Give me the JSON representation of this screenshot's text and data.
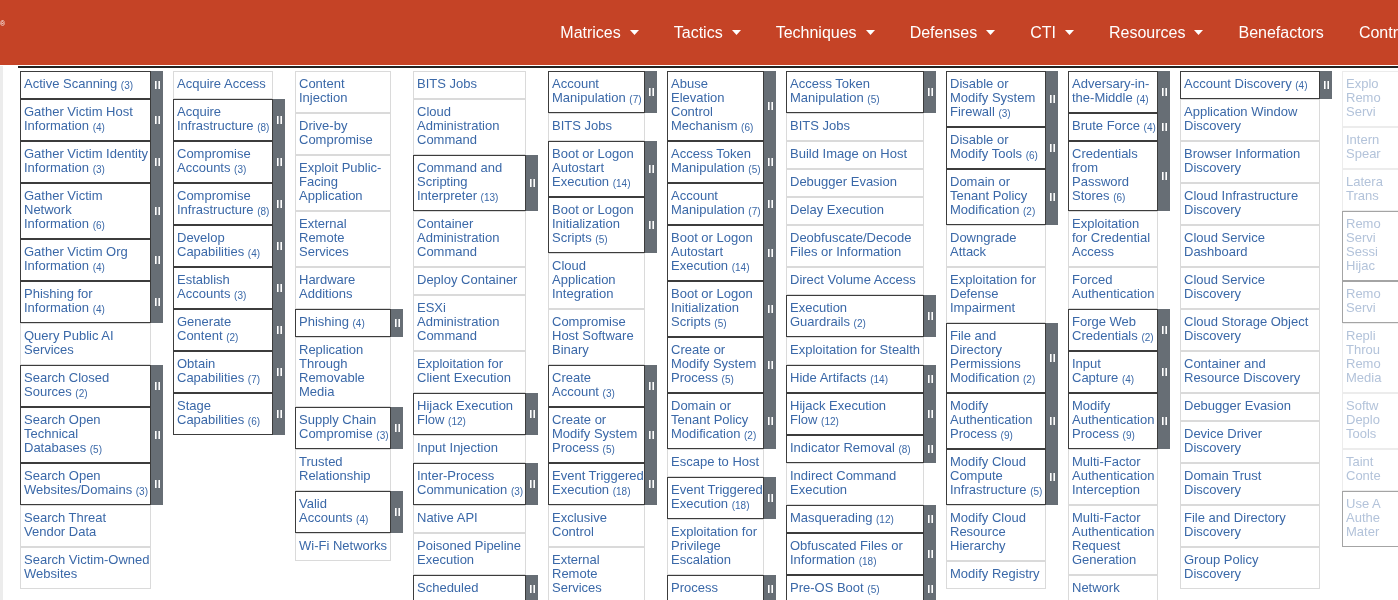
{
  "navbar": {
    "logo_mark": "®",
    "items": [
      {
        "label": "Matrices",
        "dropdown": true
      },
      {
        "label": "Tactics",
        "dropdown": true
      },
      {
        "label": "Techniques",
        "dropdown": true
      },
      {
        "label": "Defenses",
        "dropdown": true
      },
      {
        "label": "CTI",
        "dropdown": true
      },
      {
        "label": "Resources",
        "dropdown": true
      },
      {
        "label": "Benefactors",
        "dropdown": false
      },
      {
        "label": "Contr",
        "dropdown": false
      }
    ]
  },
  "matrix": {
    "columns": [
      {
        "faded": false,
        "techniques": [
          {
            "name": "Active Scanning",
            "count": "(3)",
            "kind": "parent"
          },
          {
            "name": "Gather Victim Host Information",
            "count": "(4)",
            "kind": "parent"
          },
          {
            "name": "Gather Victim Identity Information",
            "count": "(3)",
            "kind": "parent"
          },
          {
            "name": "Gather Victim Network Information",
            "count": "(6)",
            "kind": "parent"
          },
          {
            "name": "Gather Victim Org Information",
            "count": "(4)",
            "kind": "parent"
          },
          {
            "name": "Phishing for Information",
            "count": "(4)",
            "kind": "parent"
          },
          {
            "name": "Query Public AI Services",
            "kind": "single"
          },
          {
            "name": "Search Closed Sources",
            "count": "(2)",
            "kind": "parent"
          },
          {
            "name": "Search Open Technical Databases",
            "count": "(5)",
            "kind": "parent"
          },
          {
            "name": "Search Open Websites/Domains",
            "count": "(3)",
            "kind": "parent"
          },
          {
            "name": "Search Threat Vendor Data",
            "kind": "single"
          },
          {
            "name": "Search Victim-Owned Websites",
            "kind": "single"
          }
        ]
      },
      {
        "faded": false,
        "techniques": [
          {
            "name": "Acquire Access",
            "kind": "single"
          },
          {
            "name": "Acquire Infrastructure",
            "count": "(8)",
            "kind": "parent"
          },
          {
            "name": "Compromise Accounts",
            "count": "(3)",
            "kind": "parent"
          },
          {
            "name": "Compromise Infrastructure",
            "count": "(8)",
            "kind": "parent"
          },
          {
            "name": "Develop Capabilities",
            "count": "(4)",
            "kind": "parent"
          },
          {
            "name": "Establish Accounts",
            "count": "(3)",
            "kind": "parent"
          },
          {
            "name": "Generate Content",
            "count": "(2)",
            "kind": "parent"
          },
          {
            "name": "Obtain Capabilities",
            "count": "(7)",
            "kind": "parent"
          },
          {
            "name": "Stage Capabilities",
            "count": "(6)",
            "kind": "parent"
          }
        ]
      },
      {
        "faded": false,
        "techniques": [
          {
            "name": "Content Injection",
            "kind": "single"
          },
          {
            "name": "Drive-by Compromise",
            "kind": "single"
          },
          {
            "name": "Exploit Public-Facing Application",
            "kind": "single"
          },
          {
            "name": "External Remote Services",
            "kind": "single"
          },
          {
            "name": "Hardware Additions",
            "kind": "single"
          },
          {
            "name": "Phishing",
            "count": "(4)",
            "kind": "parent"
          },
          {
            "name": "Replication Through Removable Media",
            "kind": "single"
          },
          {
            "name": "Supply Chain Compromise",
            "count": "(3)",
            "kind": "parent"
          },
          {
            "name": "Trusted Relationship",
            "kind": "single"
          },
          {
            "name": "Valid Accounts",
            "count": "(4)",
            "kind": "parent"
          },
          {
            "name": "Wi-Fi Networks",
            "kind": "single"
          }
        ]
      },
      {
        "faded": false,
        "techniques": [
          {
            "name": "BITS Jobs",
            "kind": "single"
          },
          {
            "name": "Cloud Administration Command",
            "kind": "single"
          },
          {
            "name": "Command and Scripting Interpreter",
            "count": "(13)",
            "kind": "parent"
          },
          {
            "name": "Container Administration Command",
            "kind": "single"
          },
          {
            "name": "Deploy Container",
            "kind": "single"
          },
          {
            "name": "ESXi Administration Command",
            "kind": "single"
          },
          {
            "name": "Exploitation for Client Execution",
            "kind": "single"
          },
          {
            "name": "Hijack Execution Flow",
            "count": "(12)",
            "kind": "parent"
          },
          {
            "name": "Input Injection",
            "kind": "single"
          },
          {
            "name": "Inter-Process Communication",
            "count": "(3)",
            "kind": "parent"
          },
          {
            "name": "Native API",
            "kind": "single"
          },
          {
            "name": "Poisoned Pipeline Execution",
            "kind": "single"
          },
          {
            "name": "Scheduled",
            "kind": "parent"
          }
        ]
      },
      {
        "faded": false,
        "techniques": [
          {
            "name": "Account Manipulation",
            "count": "(7)",
            "kind": "parent"
          },
          {
            "name": "BITS Jobs",
            "kind": "single"
          },
          {
            "name": "Boot or Logon Autostart Execution",
            "count": "(14)",
            "kind": "parent"
          },
          {
            "name": "Boot or Logon Initialization Scripts",
            "count": "(5)",
            "kind": "parent"
          },
          {
            "name": "Cloud Application Integration",
            "kind": "single"
          },
          {
            "name": "Compromise Host Software Binary",
            "kind": "single"
          },
          {
            "name": "Create Account",
            "count": "(3)",
            "kind": "parent"
          },
          {
            "name": "Create or Modify System Process",
            "count": "(5)",
            "kind": "parent"
          },
          {
            "name": "Event Triggered Execution",
            "count": "(18)",
            "kind": "parent"
          },
          {
            "name": "Exclusive Control",
            "kind": "single"
          },
          {
            "name": "External Remote Services",
            "kind": "single"
          }
        ]
      },
      {
        "faded": false,
        "techniques": [
          {
            "name": "Abuse Elevation Control Mechanism",
            "count": "(6)",
            "kind": "parent"
          },
          {
            "name": "Access Token Manipulation",
            "count": "(5)",
            "kind": "parent"
          },
          {
            "name": "Account Manipulation",
            "count": "(7)",
            "kind": "parent"
          },
          {
            "name": "Boot or Logon Autostart Execution",
            "count": "(14)",
            "kind": "parent"
          },
          {
            "name": "Boot or Logon Initialization Scripts",
            "count": "(5)",
            "kind": "parent"
          },
          {
            "name": "Create or Modify System Process",
            "count": "(5)",
            "kind": "parent"
          },
          {
            "name": "Domain or Tenant Policy Modification",
            "count": "(2)",
            "kind": "parent"
          },
          {
            "name": "Escape to Host",
            "kind": "single"
          },
          {
            "name": "Event Triggered Execution",
            "count": "(18)",
            "kind": "parent"
          },
          {
            "name": "Exploitation for Privilege Escalation",
            "kind": "single"
          },
          {
            "name": "Process",
            "kind": "parent"
          }
        ]
      },
      {
        "faded": false,
        "techniques": [
          {
            "name": "Access Token Manipulation",
            "count": "(5)",
            "kind": "parent"
          },
          {
            "name": "BITS Jobs",
            "kind": "single"
          },
          {
            "name": "Build Image on Host",
            "kind": "single"
          },
          {
            "name": "Debugger Evasion",
            "kind": "single"
          },
          {
            "name": "Delay Execution",
            "kind": "single"
          },
          {
            "name": "Deobfuscate/Decode Files or Information",
            "kind": "single"
          },
          {
            "name": "Direct Volume Access",
            "kind": "single"
          },
          {
            "name": "Execution Guardrails",
            "count": "(2)",
            "kind": "parent"
          },
          {
            "name": "Exploitation for Stealth",
            "kind": "single"
          },
          {
            "name": "Hide Artifacts",
            "count": "(14)",
            "kind": "parent"
          },
          {
            "name": "Hijack Execution Flow",
            "count": "(12)",
            "kind": "parent"
          },
          {
            "name": "Indicator Removal",
            "count": "(8)",
            "kind": "parent"
          },
          {
            "name": "Indirect Command Execution",
            "kind": "single"
          },
          {
            "name": "Masquerading",
            "count": "(12)",
            "kind": "parent"
          },
          {
            "name": "Obfuscated Files or Information",
            "count": "(18)",
            "kind": "parent"
          },
          {
            "name": "Pre-OS Boot",
            "count": "(5)",
            "kind": "parent"
          }
        ]
      },
      {
        "faded": false,
        "techniques": [
          {
            "name": "Disable or Modify System Firewall",
            "count": "(3)",
            "kind": "parent"
          },
          {
            "name": "Disable or Modify Tools",
            "count": "(6)",
            "kind": "parent"
          },
          {
            "name": "Domain or Tenant Policy Modification",
            "count": "(2)",
            "kind": "parent"
          },
          {
            "name": "Downgrade Attack",
            "kind": "single"
          },
          {
            "name": "Exploitation for Defense Impairment",
            "kind": "single"
          },
          {
            "name": "File and Directory Permissions Modification",
            "count": "(2)",
            "kind": "parent"
          },
          {
            "name": "Modify Authentication Process",
            "count": "(9)",
            "kind": "parent"
          },
          {
            "name": "Modify Cloud Compute Infrastructure",
            "count": "(5)",
            "kind": "parent"
          },
          {
            "name": "Modify Cloud Resource Hierarchy",
            "kind": "single"
          },
          {
            "name": "Modify Registry",
            "kind": "single"
          }
        ]
      },
      {
        "faded": false,
        "techniques": [
          {
            "name": "Adversary-in-the-Middle",
            "count": "(4)",
            "kind": "parent"
          },
          {
            "name": "Brute Force",
            "count": "(4)",
            "kind": "parent"
          },
          {
            "name": "Credentials from Password Stores",
            "count": "(6)",
            "kind": "parent"
          },
          {
            "name": "Exploitation for Credential Access",
            "kind": "single"
          },
          {
            "name": "Forced Authentication",
            "kind": "single"
          },
          {
            "name": "Forge Web Credentials",
            "count": "(2)",
            "kind": "parent"
          },
          {
            "name": "Input Capture",
            "count": "(4)",
            "kind": "parent"
          },
          {
            "name": "Modify Authentication Process",
            "count": "(9)",
            "kind": "parent"
          },
          {
            "name": "Multi-Factor Authentication Interception",
            "kind": "single"
          },
          {
            "name": "Multi-Factor Authentication Request Generation",
            "kind": "single"
          },
          {
            "name": "Network",
            "kind": "single"
          }
        ]
      },
      {
        "faded": false,
        "techniques": [
          {
            "name": "Account Discovery",
            "count": "(4)",
            "kind": "parent"
          },
          {
            "name": "Application Window Discovery",
            "kind": "single"
          },
          {
            "name": "Browser Information Discovery",
            "kind": "single"
          },
          {
            "name": "Cloud Infrastructure Discovery",
            "kind": "single"
          },
          {
            "name": "Cloud Service Dashboard",
            "kind": "single"
          },
          {
            "name": "Cloud Service Discovery",
            "kind": "single"
          },
          {
            "name": "Cloud Storage Object Discovery",
            "kind": "single"
          },
          {
            "name": "Container and Resource Discovery",
            "kind": "single"
          },
          {
            "name": "Debugger Evasion",
            "kind": "single"
          },
          {
            "name": "Device Driver Discovery",
            "kind": "single"
          },
          {
            "name": "Domain Trust Discovery",
            "kind": "single"
          },
          {
            "name": "File and Directory Discovery",
            "kind": "single"
          },
          {
            "name": "Group Policy Discovery",
            "kind": "single"
          }
        ]
      },
      {
        "faded": true,
        "techniques": [
          {
            "name": "Explo\nRemo\nServi",
            "kind": "single"
          },
          {
            "name": "Intern\nSpear",
            "kind": "single"
          },
          {
            "name": "Latera\nTrans",
            "kind": "single"
          },
          {
            "name": "Remo\nServi\nSessi\nHijac",
            "kind": "parent"
          },
          {
            "name": "Remo\nServi",
            "kind": "parent"
          },
          {
            "name": "Repli\nThrou\nRemo\nMedia",
            "kind": "single"
          },
          {
            "name": "Softw\nDeplo\nTools",
            "kind": "single"
          },
          {
            "name": "Taint\nConte",
            "kind": "single"
          },
          {
            "name": "Use A\nAuthe\nMater",
            "kind": "parent"
          }
        ]
      }
    ]
  }
}
